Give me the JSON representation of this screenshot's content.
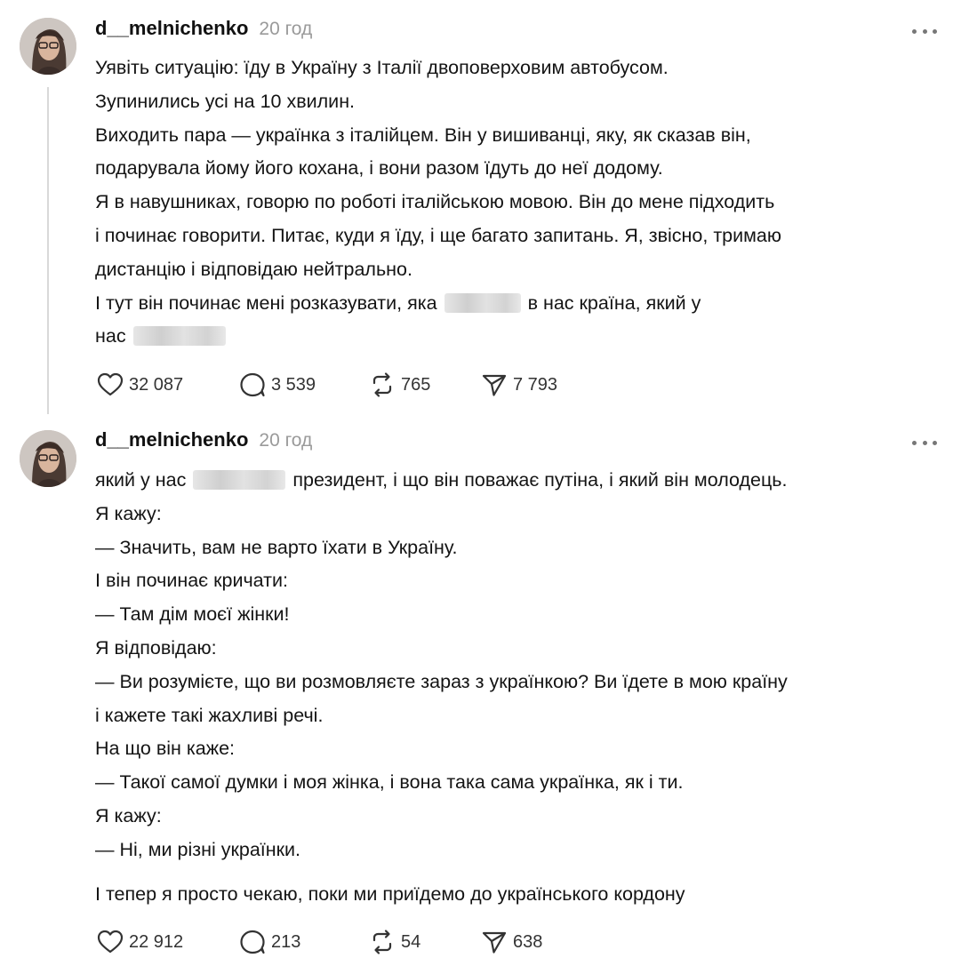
{
  "posts": [
    {
      "username": "d__melnichenko",
      "time": "20 год",
      "lines": [
        "Уявіть ситуацію: їду в Україну з Італії двоповерховим автобусом.",
        "Зупинились усі на 10 хвилин.",
        "Виходить пара — українка з італійцем. Він у вишиванці, яку, як сказав він,",
        "подарувала йому його кохана, і вони разом їдуть до неї додому.",
        "Я в навушниках, говорю по роботі італійською мовою. Він до мене підходить",
        "і починає говорити. Питає, куди я їду, і ще багато запитань. Я, звісно, тримаю",
        "дистанцію і відповідаю нейтрально."
      ],
      "line8_before": "І тут він починає мені розказувати, яка",
      "line8_after": "в нас країна, який у",
      "line9_before": "нас",
      "likes": "32 087",
      "replies": "3 539",
      "reposts": "765",
      "shares": "7 793"
    },
    {
      "username": "d__melnichenko",
      "time": "20 год",
      "line1_before": "який у нас",
      "line1_after": "президент, і що він поважає путіна, і який він молодець.",
      "lines": [
        "Я кажу:",
        "— Значить, вам не варто їхати в Україну.",
        "І він починає кричати:",
        "— Там дім моєї жінки!",
        "Я відповідаю:",
        "— Ви розумієте, що ви розмовляєте зараз з українкою? Ви їдете в мою країну",
        "і кажете такі жахливі речі.",
        "На що він каже:",
        "— Такої самої думки і моя жінка, і вона така сама українка, як і ти.",
        "Я кажу:",
        "— Ні, ми різні українки."
      ],
      "final_line": "І тепер я просто чекаю, поки ми приїдемо до українського кордону",
      "likes": "22 912",
      "replies": "213",
      "reposts": "54",
      "shares": "638"
    }
  ],
  "icons": {
    "like": "heart-icon",
    "reply": "comment-icon",
    "repost": "repost-icon",
    "share": "send-icon",
    "more": "more-icon"
  }
}
